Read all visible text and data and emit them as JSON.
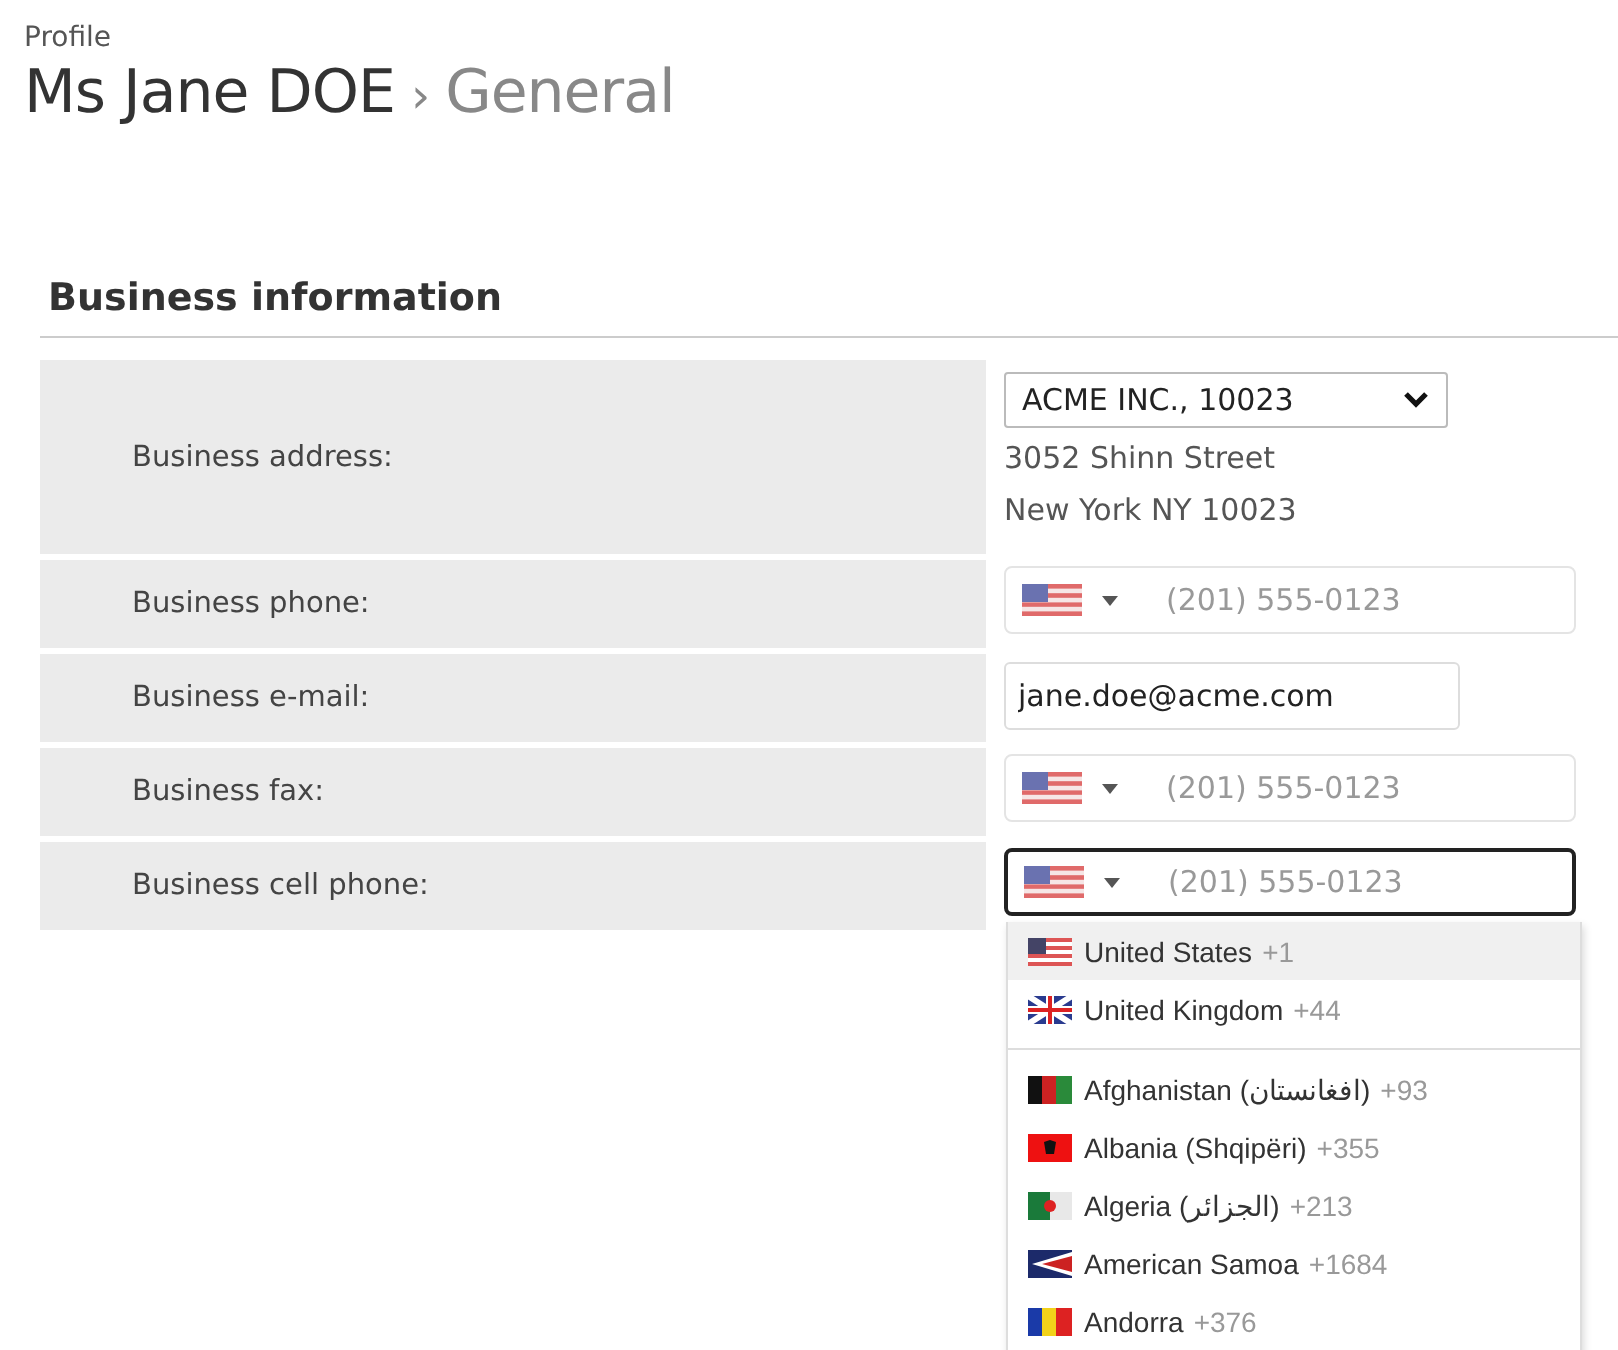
{
  "breadcrumb": {
    "parent": "Profile",
    "title": "Ms Jane DOE",
    "separator": "›",
    "current": "General"
  },
  "section": {
    "title": "Business information"
  },
  "fields": [
    {
      "kind": "address",
      "label": "Business address:",
      "value": "ACME INC., 10023",
      "lines": [
        "3052 Shinn Street",
        "New York NY 10023"
      ]
    },
    {
      "kind": "phone",
      "label": "Business phone:",
      "placeholder": "(201) 555-0123",
      "focused": false,
      "open": false
    },
    {
      "kind": "email",
      "label": "Business e-mail:",
      "value": "jane.doe@acme.com"
    },
    {
      "kind": "phone",
      "label": "Business fax:",
      "placeholder": "(201) 555-0123",
      "focused": false,
      "open": false
    },
    {
      "kind": "phone",
      "label": "Business cell phone:",
      "placeholder": "(201) 555-0123",
      "focused": true,
      "open": true
    }
  ],
  "country_dropdown": {
    "preferred": [
      {
        "name": "United States",
        "code": "+1",
        "selected": true
      },
      {
        "name": "United Kingdom",
        "code": "+44",
        "selected": false
      }
    ],
    "countries": [
      {
        "name": "Afghanistan (‫افغانستان‬‎)",
        "code": "+93",
        "selected": false
      },
      {
        "name": "Albania (Shqipëri)",
        "code": "+355",
        "selected": false
      },
      {
        "name": "Algeria (‫الجزائر‬‎)",
        "code": "+213",
        "selected": false
      },
      {
        "name": "American Samoa",
        "code": "+1684",
        "selected": false
      },
      {
        "name": "Andorra",
        "code": "+376",
        "selected": false
      }
    ]
  }
}
